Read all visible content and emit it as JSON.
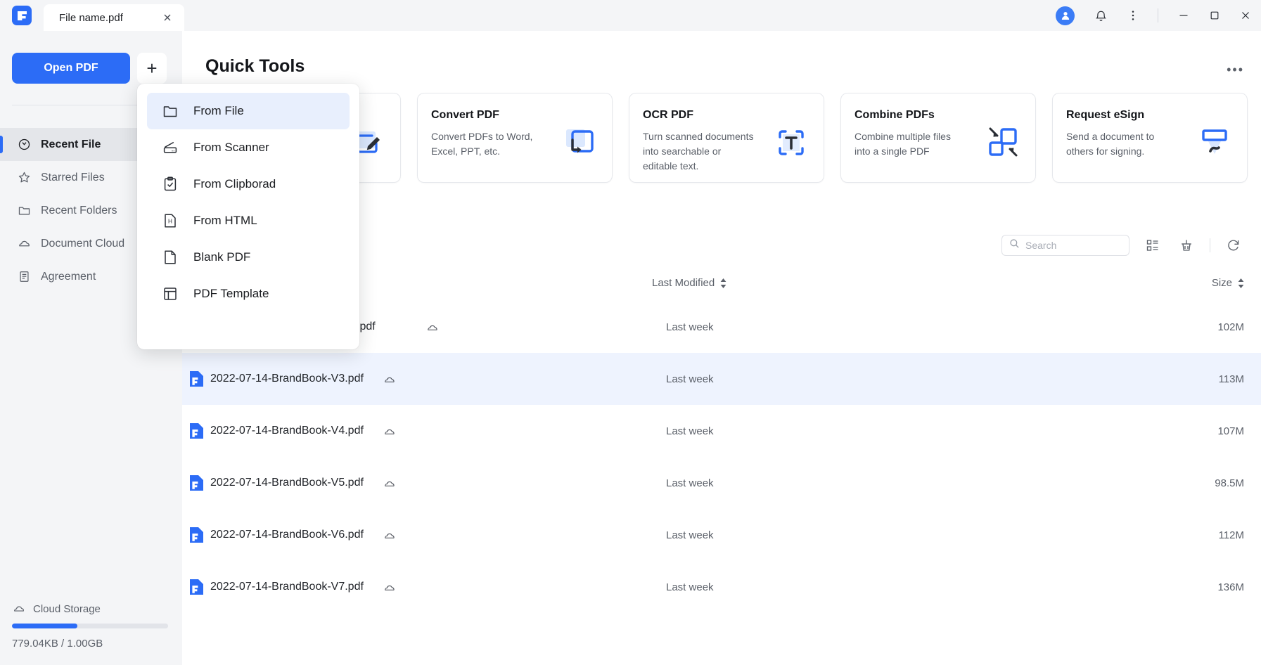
{
  "titlebar": {
    "tab_title": "File name.pdf",
    "close_icon": "close-icon",
    "avatar_icon": "user-avatar-icon",
    "bell_icon": "notification-bell-icon",
    "kebab_icon": "more-vertical-icon",
    "minimize_icon": "minimize-icon",
    "maximize_icon": "maximize-icon",
    "close_window_icon": "window-close-icon"
  },
  "sidebar": {
    "open_pdf_label": "Open PDF",
    "plus_label": "+",
    "items": [
      {
        "label": "Recent File",
        "icon": "clock-icon",
        "active": true
      },
      {
        "label": "Starred Files",
        "icon": "star-icon",
        "active": false
      },
      {
        "label": "Recent Folders",
        "icon": "folder-icon",
        "active": false
      },
      {
        "label": "Document Cloud",
        "icon": "cloud-icon",
        "active": false
      },
      {
        "label": "Agreement",
        "icon": "document-lines-icon",
        "active": false
      }
    ],
    "cloud_storage_label": "Cloud Storage",
    "cloud_storage_icon": "cloud-icon",
    "cloud_usage": "779.04KB / 1.00GB",
    "cloud_progress_percent": 42
  },
  "main": {
    "page_title": "Quick Tools",
    "more_dots": "•••",
    "cards": [
      {
        "title": "",
        "desc": "",
        "icon": "edit-pdf-icon",
        "hidden_by_menu": true
      },
      {
        "title": "Convert PDF",
        "desc": "Convert PDFs to Word, Excel, PPT, etc.",
        "icon": "convert-pdf-icon"
      },
      {
        "title": "OCR PDF",
        "desc": "Turn scanned documents into searchable or editable text.",
        "icon": "ocr-pdf-icon"
      },
      {
        "title": "Combine PDFs",
        "desc": "Combine multiple files into a single PDF",
        "icon": "combine-pdfs-icon"
      },
      {
        "title": "Request eSign",
        "desc": "Send a document to others for signing.",
        "icon": "request-esign-icon"
      }
    ],
    "toolbar": {
      "search_placeholder": "Search",
      "search_value": "",
      "search_icon": "search-icon",
      "list_view_icon": "list-view-icon",
      "clean_icon": "broom-clean-icon",
      "refresh_icon": "refresh-icon"
    },
    "table": {
      "headers": {
        "modified": "Last Modified",
        "size": "Size"
      },
      "rows": [
        {
          "name": "ok_overview.pdf",
          "modified": "Last week",
          "size": "102M",
          "cloud": true,
          "selected": false,
          "clipped": true
        },
        {
          "name": "2022-07-14-BrandBook-V3.pdf",
          "modified": "Last week",
          "size": "113M",
          "cloud": true,
          "selected": true,
          "clipped": false
        },
        {
          "name": "2022-07-14-BrandBook-V4.pdf",
          "modified": "Last week",
          "size": "107M",
          "cloud": true,
          "selected": false,
          "clipped": false
        },
        {
          "name": "2022-07-14-BrandBook-V5.pdf",
          "modified": "Last week",
          "size": "98.5M",
          "cloud": true,
          "selected": false,
          "clipped": false
        },
        {
          "name": "2022-07-14-BrandBook-V6.pdf",
          "modified": "Last week",
          "size": "112M",
          "cloud": true,
          "selected": false,
          "clipped": false
        },
        {
          "name": "2022-07-14-BrandBook-V7.pdf",
          "modified": "Last week",
          "size": "136M",
          "cloud": true,
          "selected": false,
          "clipped": false
        }
      ]
    }
  },
  "menu": {
    "items": [
      {
        "label": "From File",
        "icon": "folder-icon",
        "highlighted": true
      },
      {
        "label": "From Scanner",
        "icon": "scanner-icon",
        "highlighted": false
      },
      {
        "label": "From Clipborad",
        "icon": "clipboard-check-icon",
        "highlighted": false
      },
      {
        "label": "From HTML",
        "icon": "html-file-icon",
        "highlighted": false
      },
      {
        "label": "Blank PDF",
        "icon": "blank-page-icon",
        "highlighted": false
      },
      {
        "label": "PDF Template",
        "icon": "template-icon",
        "highlighted": false
      }
    ]
  },
  "colors": {
    "accent": "#2c6cf6",
    "sidebar_bg": "#f4f5f7",
    "selected_row": "#eef3fe",
    "menu_highlight": "#e8effd"
  }
}
